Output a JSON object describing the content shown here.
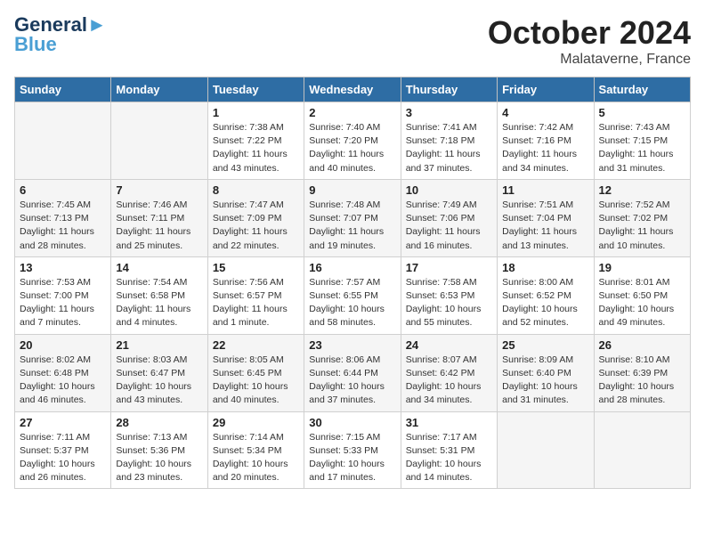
{
  "header": {
    "logo_line1": "General",
    "logo_line2": "Blue",
    "month": "October 2024",
    "location": "Malataverne, France"
  },
  "weekdays": [
    "Sunday",
    "Monday",
    "Tuesday",
    "Wednesday",
    "Thursday",
    "Friday",
    "Saturday"
  ],
  "weeks": [
    [
      {
        "day": "",
        "sunrise": "",
        "sunset": "",
        "daylight": ""
      },
      {
        "day": "",
        "sunrise": "",
        "sunset": "",
        "daylight": ""
      },
      {
        "day": "1",
        "sunrise": "Sunrise: 7:38 AM",
        "sunset": "Sunset: 7:22 PM",
        "daylight": "Daylight: 11 hours and 43 minutes."
      },
      {
        "day": "2",
        "sunrise": "Sunrise: 7:40 AM",
        "sunset": "Sunset: 7:20 PM",
        "daylight": "Daylight: 11 hours and 40 minutes."
      },
      {
        "day": "3",
        "sunrise": "Sunrise: 7:41 AM",
        "sunset": "Sunset: 7:18 PM",
        "daylight": "Daylight: 11 hours and 37 minutes."
      },
      {
        "day": "4",
        "sunrise": "Sunrise: 7:42 AM",
        "sunset": "Sunset: 7:16 PM",
        "daylight": "Daylight: 11 hours and 34 minutes."
      },
      {
        "day": "5",
        "sunrise": "Sunrise: 7:43 AM",
        "sunset": "Sunset: 7:15 PM",
        "daylight": "Daylight: 11 hours and 31 minutes."
      }
    ],
    [
      {
        "day": "6",
        "sunrise": "Sunrise: 7:45 AM",
        "sunset": "Sunset: 7:13 PM",
        "daylight": "Daylight: 11 hours and 28 minutes."
      },
      {
        "day": "7",
        "sunrise": "Sunrise: 7:46 AM",
        "sunset": "Sunset: 7:11 PM",
        "daylight": "Daylight: 11 hours and 25 minutes."
      },
      {
        "day": "8",
        "sunrise": "Sunrise: 7:47 AM",
        "sunset": "Sunset: 7:09 PM",
        "daylight": "Daylight: 11 hours and 22 minutes."
      },
      {
        "day": "9",
        "sunrise": "Sunrise: 7:48 AM",
        "sunset": "Sunset: 7:07 PM",
        "daylight": "Daylight: 11 hours and 19 minutes."
      },
      {
        "day": "10",
        "sunrise": "Sunrise: 7:49 AM",
        "sunset": "Sunset: 7:06 PM",
        "daylight": "Daylight: 11 hours and 16 minutes."
      },
      {
        "day": "11",
        "sunrise": "Sunrise: 7:51 AM",
        "sunset": "Sunset: 7:04 PM",
        "daylight": "Daylight: 11 hours and 13 minutes."
      },
      {
        "day": "12",
        "sunrise": "Sunrise: 7:52 AM",
        "sunset": "Sunset: 7:02 PM",
        "daylight": "Daylight: 11 hours and 10 minutes."
      }
    ],
    [
      {
        "day": "13",
        "sunrise": "Sunrise: 7:53 AM",
        "sunset": "Sunset: 7:00 PM",
        "daylight": "Daylight: 11 hours and 7 minutes."
      },
      {
        "day": "14",
        "sunrise": "Sunrise: 7:54 AM",
        "sunset": "Sunset: 6:58 PM",
        "daylight": "Daylight: 11 hours and 4 minutes."
      },
      {
        "day": "15",
        "sunrise": "Sunrise: 7:56 AM",
        "sunset": "Sunset: 6:57 PM",
        "daylight": "Daylight: 11 hours and 1 minute."
      },
      {
        "day": "16",
        "sunrise": "Sunrise: 7:57 AM",
        "sunset": "Sunset: 6:55 PM",
        "daylight": "Daylight: 10 hours and 58 minutes."
      },
      {
        "day": "17",
        "sunrise": "Sunrise: 7:58 AM",
        "sunset": "Sunset: 6:53 PM",
        "daylight": "Daylight: 10 hours and 55 minutes."
      },
      {
        "day": "18",
        "sunrise": "Sunrise: 8:00 AM",
        "sunset": "Sunset: 6:52 PM",
        "daylight": "Daylight: 10 hours and 52 minutes."
      },
      {
        "day": "19",
        "sunrise": "Sunrise: 8:01 AM",
        "sunset": "Sunset: 6:50 PM",
        "daylight": "Daylight: 10 hours and 49 minutes."
      }
    ],
    [
      {
        "day": "20",
        "sunrise": "Sunrise: 8:02 AM",
        "sunset": "Sunset: 6:48 PM",
        "daylight": "Daylight: 10 hours and 46 minutes."
      },
      {
        "day": "21",
        "sunrise": "Sunrise: 8:03 AM",
        "sunset": "Sunset: 6:47 PM",
        "daylight": "Daylight: 10 hours and 43 minutes."
      },
      {
        "day": "22",
        "sunrise": "Sunrise: 8:05 AM",
        "sunset": "Sunset: 6:45 PM",
        "daylight": "Daylight: 10 hours and 40 minutes."
      },
      {
        "day": "23",
        "sunrise": "Sunrise: 8:06 AM",
        "sunset": "Sunset: 6:44 PM",
        "daylight": "Daylight: 10 hours and 37 minutes."
      },
      {
        "day": "24",
        "sunrise": "Sunrise: 8:07 AM",
        "sunset": "Sunset: 6:42 PM",
        "daylight": "Daylight: 10 hours and 34 minutes."
      },
      {
        "day": "25",
        "sunrise": "Sunrise: 8:09 AM",
        "sunset": "Sunset: 6:40 PM",
        "daylight": "Daylight: 10 hours and 31 minutes."
      },
      {
        "day": "26",
        "sunrise": "Sunrise: 8:10 AM",
        "sunset": "Sunset: 6:39 PM",
        "daylight": "Daylight: 10 hours and 28 minutes."
      }
    ],
    [
      {
        "day": "27",
        "sunrise": "Sunrise: 7:11 AM",
        "sunset": "Sunset: 5:37 PM",
        "daylight": "Daylight: 10 hours and 26 minutes."
      },
      {
        "day": "28",
        "sunrise": "Sunrise: 7:13 AM",
        "sunset": "Sunset: 5:36 PM",
        "daylight": "Daylight: 10 hours and 23 minutes."
      },
      {
        "day": "29",
        "sunrise": "Sunrise: 7:14 AM",
        "sunset": "Sunset: 5:34 PM",
        "daylight": "Daylight: 10 hours and 20 minutes."
      },
      {
        "day": "30",
        "sunrise": "Sunrise: 7:15 AM",
        "sunset": "Sunset: 5:33 PM",
        "daylight": "Daylight: 10 hours and 17 minutes."
      },
      {
        "day": "31",
        "sunrise": "Sunrise: 7:17 AM",
        "sunset": "Sunset: 5:31 PM",
        "daylight": "Daylight: 10 hours and 14 minutes."
      },
      {
        "day": "",
        "sunrise": "",
        "sunset": "",
        "daylight": ""
      },
      {
        "day": "",
        "sunrise": "",
        "sunset": "",
        "daylight": ""
      }
    ]
  ]
}
